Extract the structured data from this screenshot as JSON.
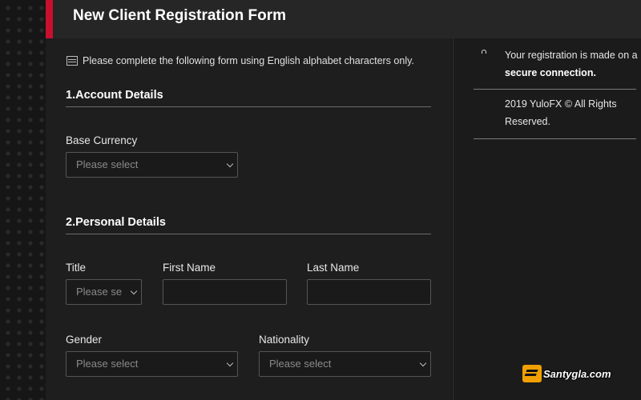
{
  "header": {
    "title": "New Client Registration Form"
  },
  "notice": {
    "text": "Please complete the following form using English alphabet characters only."
  },
  "sections": {
    "account": {
      "title": "1.Account Details",
      "base_currency": {
        "label": "Base Currency",
        "placeholder": "Please select"
      }
    },
    "personal": {
      "title": "2.Personal Details",
      "title_field": {
        "label": "Title",
        "placeholder": "Please select"
      },
      "first_name": {
        "label": "First Name",
        "value": ""
      },
      "last_name": {
        "label": "Last Name",
        "value": ""
      },
      "gender": {
        "label": "Gender",
        "placeholder": "Please select"
      },
      "nationality": {
        "label": "Nationality",
        "placeholder": "Please select"
      }
    }
  },
  "sidebar": {
    "secure": {
      "text_before": "Your registration is made on a ",
      "text_bold": "secure connection."
    },
    "copyright": {
      "text": "2019 YuloFX © All Rights Reserved."
    }
  },
  "watermark": {
    "text": "Santygla.com"
  },
  "colors": {
    "accent": "#c8102e",
    "header_bg": "#262626",
    "main_bg": "#1e1e1e"
  }
}
